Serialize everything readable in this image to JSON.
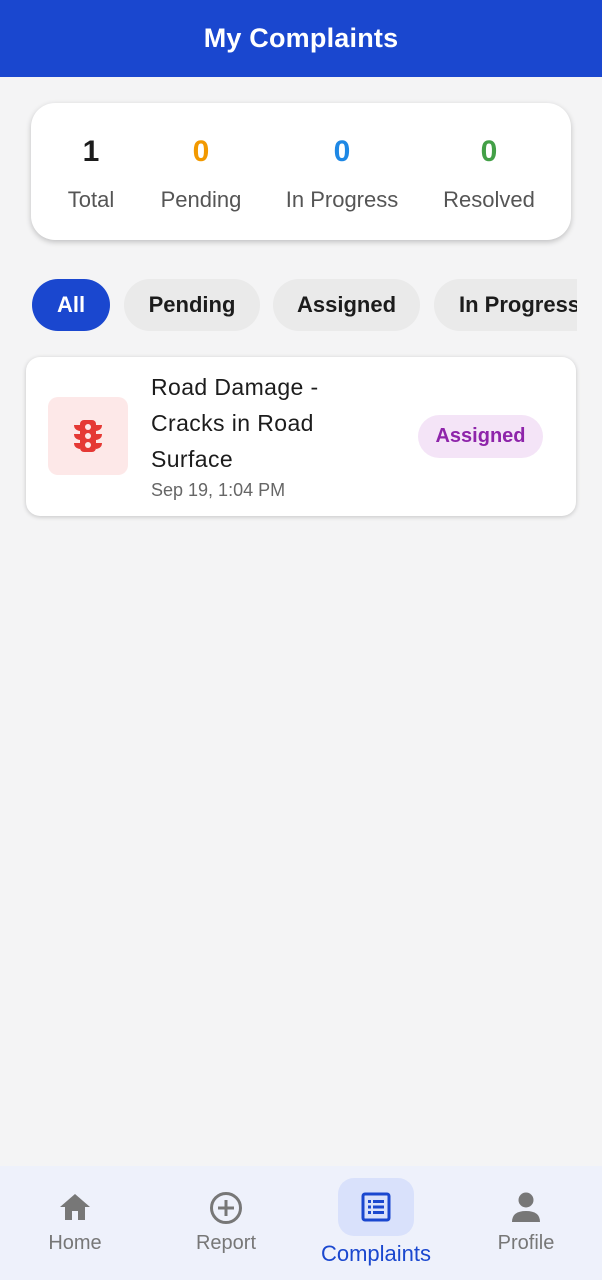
{
  "header": {
    "title": "My Complaints"
  },
  "stats": [
    {
      "key": "total",
      "value": "1",
      "label": "Total",
      "color": "#1c1c1c"
    },
    {
      "key": "pending",
      "value": "0",
      "label": "Pending",
      "color": "#f29900"
    },
    {
      "key": "in_progress",
      "value": "0",
      "label": "In Progress",
      "color": "#1e88e5"
    },
    {
      "key": "resolved",
      "value": "0",
      "label": "Resolved",
      "color": "#43a047"
    }
  ],
  "filters": {
    "selected": "All",
    "options": [
      "All",
      "Pending",
      "Assigned",
      "In Progress"
    ]
  },
  "complaints": [
    {
      "category_icon": "traffic-light-icon",
      "title": "Road Damage - Cracks in Road Surface",
      "date": "Sep 19, 1:04 PM",
      "status": "Assigned"
    }
  ],
  "bottom_nav": {
    "active": "Complaints",
    "items": [
      {
        "label": "Home",
        "icon": "home-icon"
      },
      {
        "label": "Report",
        "icon": "add-circle-icon"
      },
      {
        "label": "Complaints",
        "icon": "list-icon"
      },
      {
        "label": "Profile",
        "icon": "person-icon"
      }
    ]
  },
  "colors": {
    "primary": "#1a47cf",
    "assigned_badge_text": "#8e24aa",
    "assigned_badge_bg": "#f4e4f7",
    "category_icon": "#e53935"
  }
}
